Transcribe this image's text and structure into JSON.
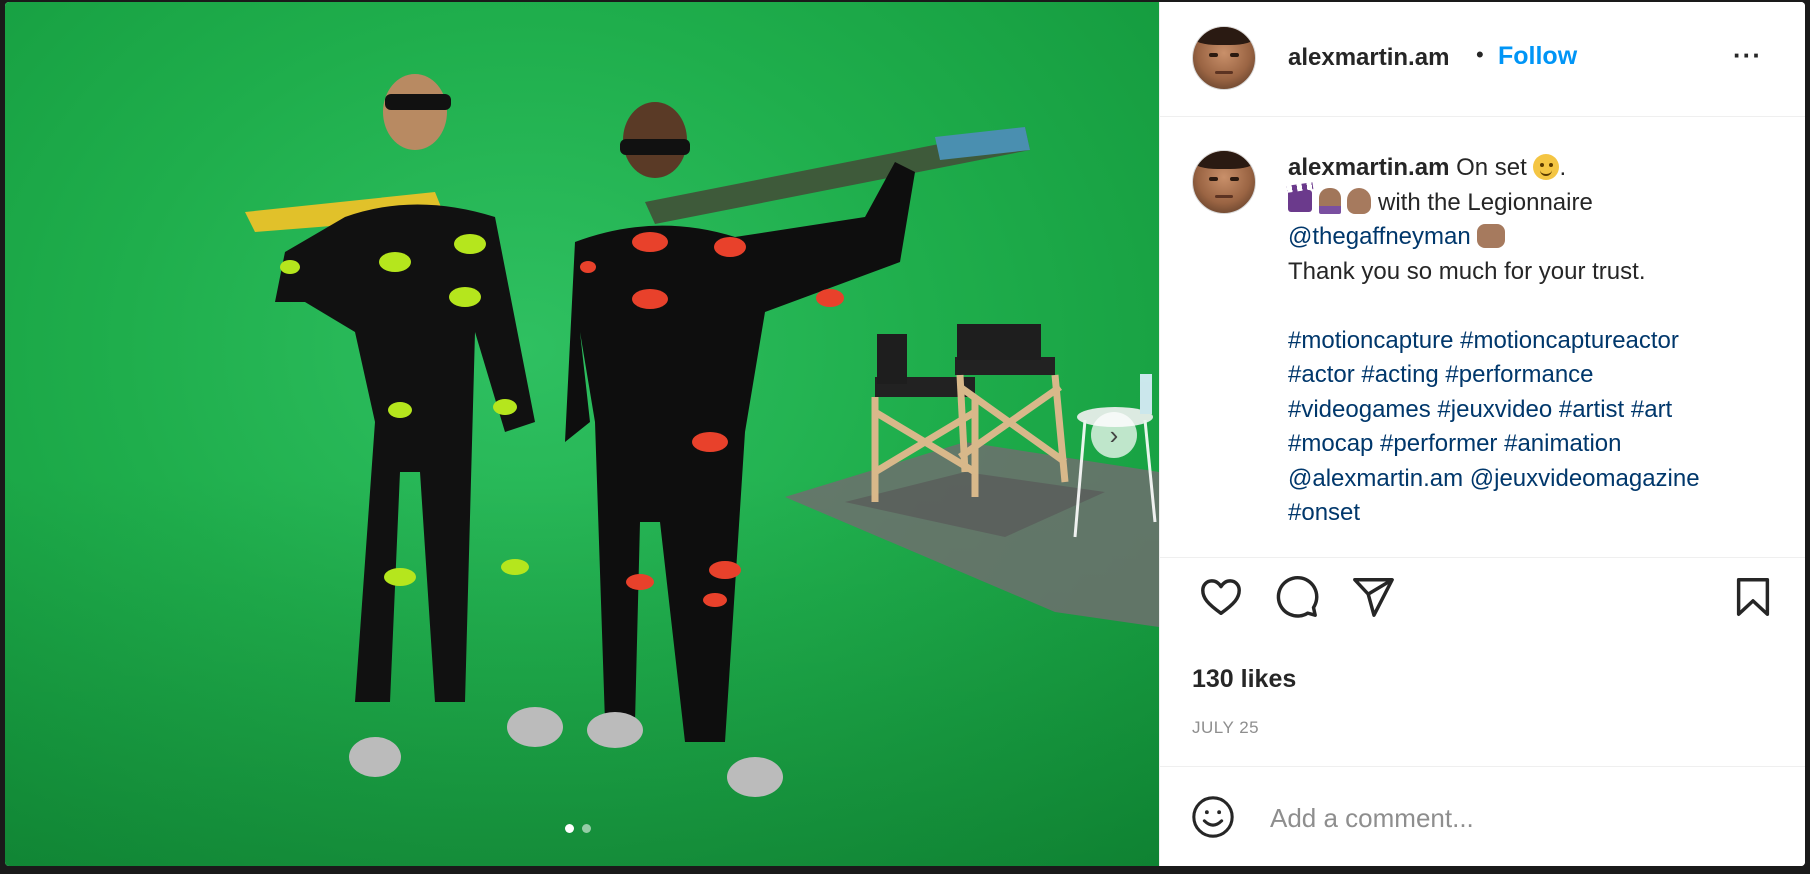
{
  "post": {
    "media": {
      "slide_count": 2,
      "active_slide": 1
    },
    "header": {
      "username": "alexmartin.am",
      "separator": "•",
      "follow_label": "Follow",
      "more_label": "···"
    },
    "caption": {
      "username": "alexmartin.am",
      "line1_text": " On set ",
      "line1_end": ".",
      "line2_text": " with the Legionnaire",
      "line3_mention": "@thegaffneyman",
      "line4_text": "Thank you so much for your trust.",
      "hashtag_lines": [
        "#motioncapture #motioncaptureactor",
        "#actor #acting #performance",
        "#videogames #jeuxvideo #artist #art",
        "#mocap #performer #animation",
        "@alexmartin.am @jeuxvideomagazine",
        "#onset"
      ]
    },
    "likes": "130 likes",
    "date": "JULY 25",
    "comment": {
      "placeholder": "Add a comment..."
    }
  },
  "colors": {
    "follow_blue": "#0095f6",
    "hashtag_blue": "#00376b",
    "green_screen": "#1fae4c",
    "text": "#262626",
    "muted": "#8e8e8e"
  },
  "icons": {
    "like": "heart-icon",
    "comment": "comment-bubble-icon",
    "share": "paper-plane-icon",
    "save": "bookmark-icon",
    "emoji": "smiley-face-icon",
    "next": "chevron-right-icon",
    "more": "ellipsis-icon"
  }
}
